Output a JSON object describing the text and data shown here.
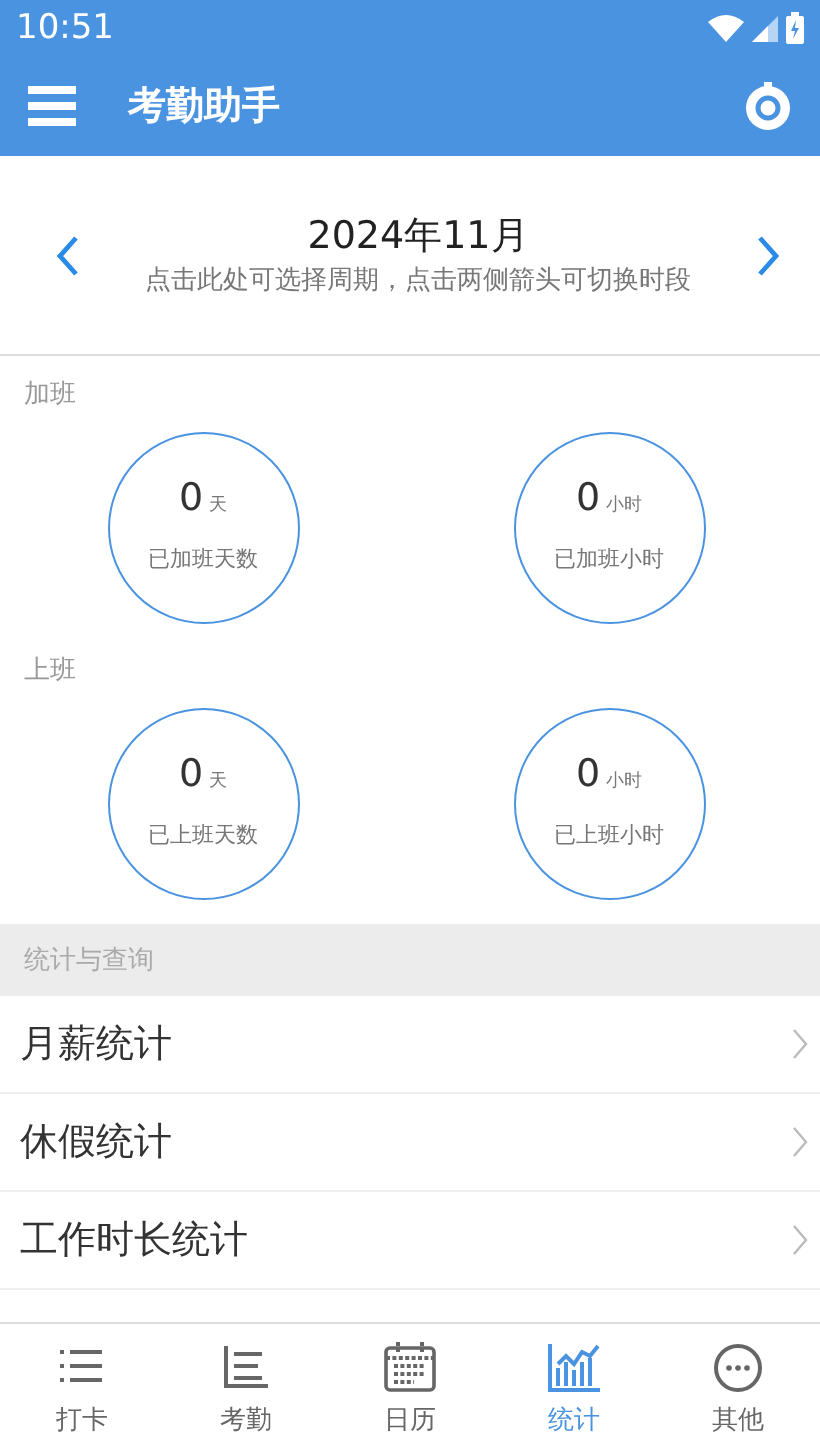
{
  "status_bar": {
    "time": "10:51"
  },
  "app_bar": {
    "title": "考勤助手"
  },
  "period": {
    "title": "2024年11月",
    "hint": "点击此处可选择周期，点击两侧箭头可切换时段"
  },
  "stat_groups": [
    {
      "label": "加班",
      "stats": [
        {
          "value": "0",
          "unit": "天",
          "label": "已加班天数"
        },
        {
          "value": "0",
          "unit": "小时",
          "label": "已加班小时"
        }
      ]
    },
    {
      "label": "上班",
      "stats": [
        {
          "value": "0",
          "unit": "天",
          "label": "已上班天数"
        },
        {
          "value": "0",
          "unit": "小时",
          "label": "已上班小时"
        }
      ]
    }
  ],
  "query": {
    "header": "统计与查询",
    "items": [
      "月薪统计",
      "休假统计",
      "工作时长统计"
    ]
  },
  "bottom_nav": [
    {
      "label": "打卡",
      "selected": false
    },
    {
      "label": "考勤",
      "selected": false
    },
    {
      "label": "日历",
      "selected": false
    },
    {
      "label": "统计",
      "selected": true
    },
    {
      "label": "其他",
      "selected": false
    }
  ]
}
